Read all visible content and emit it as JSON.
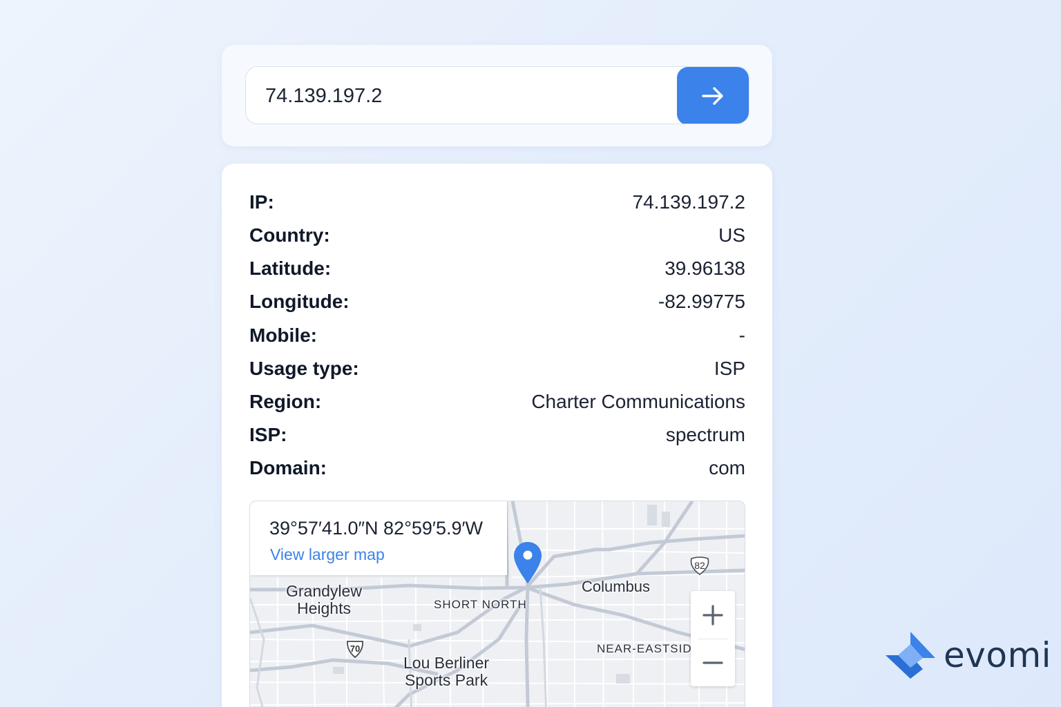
{
  "search": {
    "value": "74.139.197.2",
    "submit_icon": "arrow-right-icon",
    "accent_color": "#3b82ea"
  },
  "info": [
    {
      "label": "IP:",
      "value": "74.139.197.2"
    },
    {
      "label": "Country:",
      "value": "US"
    },
    {
      "label": "Latitude:",
      "value": "39.96138"
    },
    {
      "label": "Longitude:",
      "value": "-82.99775"
    },
    {
      "label": "Mobile:",
      "value": "-"
    },
    {
      "label": "Usage type:",
      "value": "ISP"
    },
    {
      "label": "Region:",
      "value": "Charter Communications"
    },
    {
      "label": "ISP:",
      "value": "spectrum"
    },
    {
      "label": "Domain:",
      "value": "com"
    }
  ],
  "map": {
    "coordinates": "39°57′41.0″N 82°59′5.9′W",
    "link_label": "View larger map",
    "labels": {
      "grandview": "Grandylew\nHeights",
      "short_north": "SHORT NORTH",
      "columbus": "Columbus",
      "near_east": "NEAR-EASTSID",
      "lou_berliner": "Lou Berliner\nSports Park"
    },
    "shields": {
      "us_route": "82",
      "interstate": "70"
    },
    "zoom_in_icon": "plus-icon",
    "zoom_out_icon": "minus-icon",
    "marker_icon": "map-pin-icon"
  },
  "brand": {
    "name": "evomi",
    "logo_icon": "evomi-logo-icon",
    "color": "#1f3552"
  }
}
